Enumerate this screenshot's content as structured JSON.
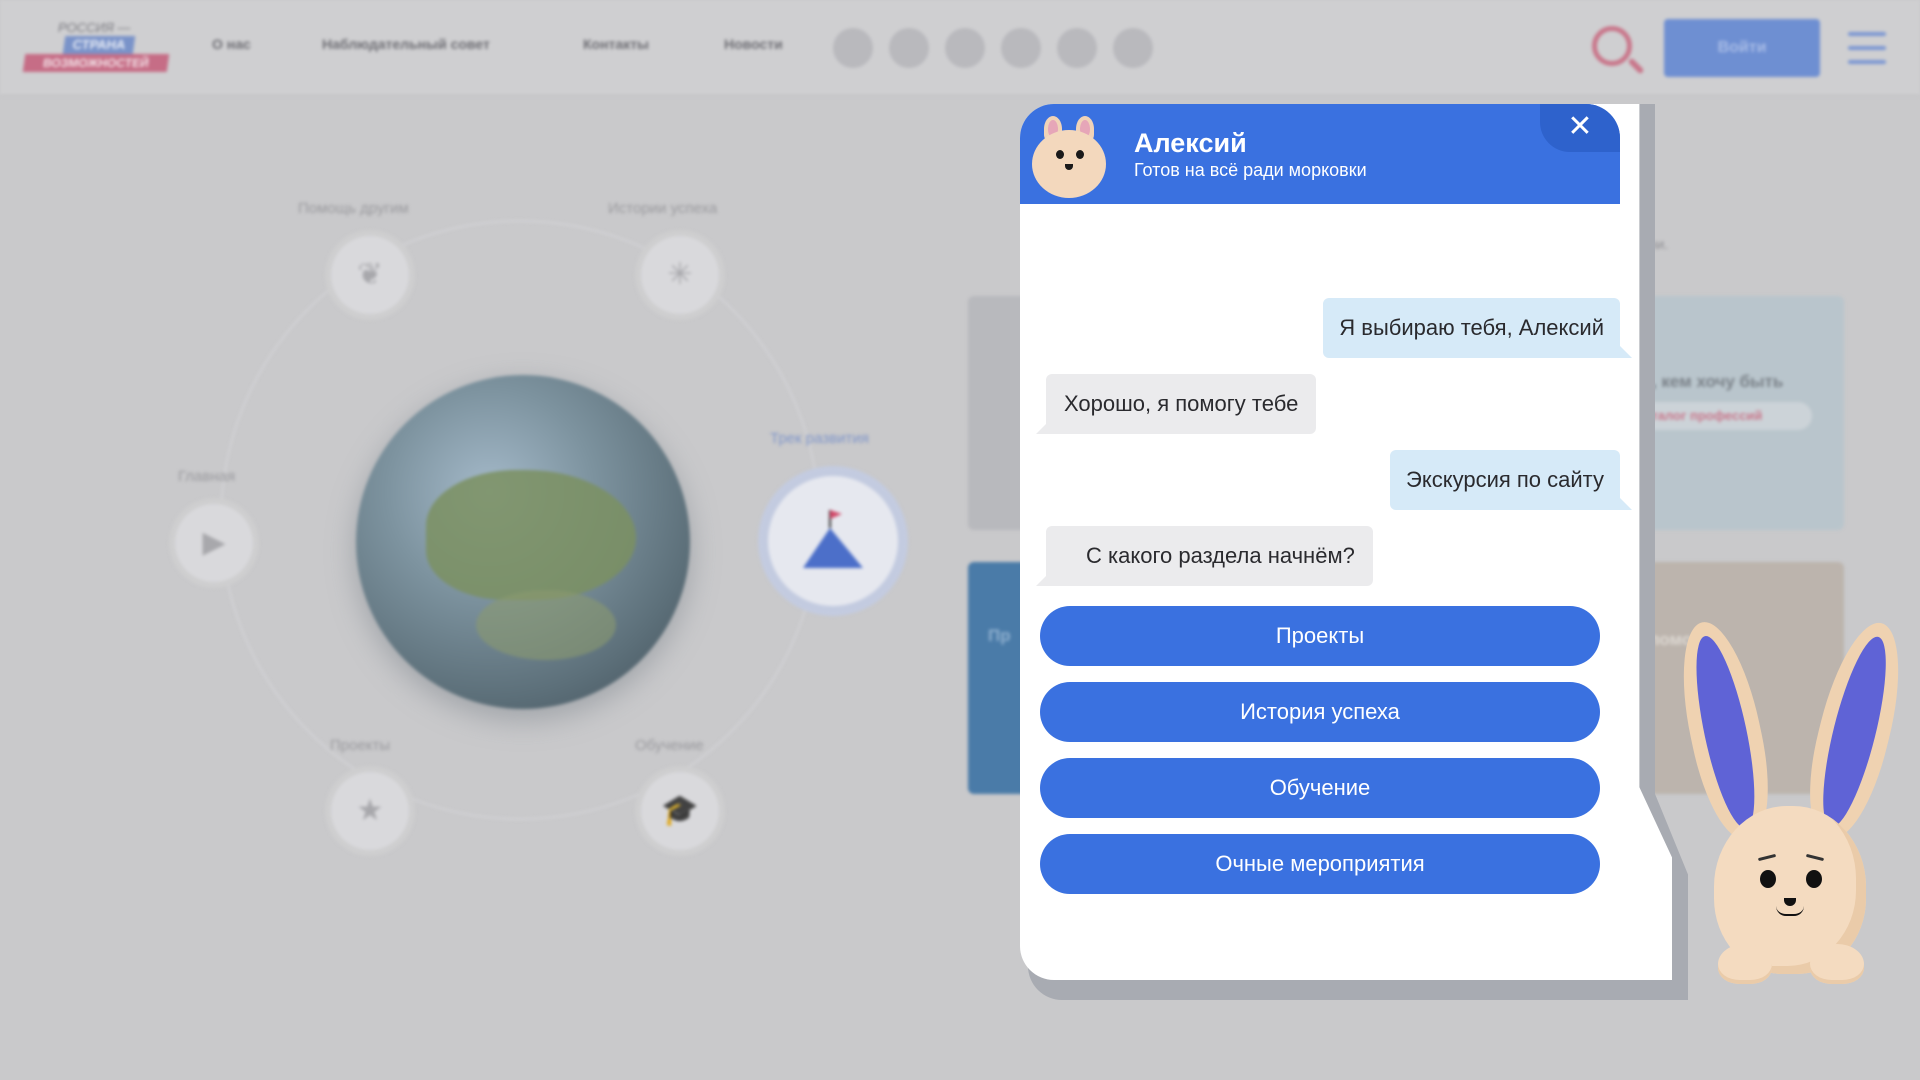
{
  "background": {
    "logo": {
      "line1": "РОССИЯ —",
      "line2": "СТРАНА",
      "line3": "ВОЗМОЖНОСТЕЙ"
    },
    "nav": [
      "О нас",
      "Наблюдательный совет",
      "Контакты",
      "Новости"
    ],
    "social_icons": [
      "vk-icon",
      "odnoklassniki-icon",
      "instagram-icon",
      "facebook-icon",
      "telegram-icon",
      "youtube-icon"
    ],
    "login_label": "Войти",
    "orbit_nodes": {
      "help": "Помощь другим",
      "stories": "Истории успеха",
      "main": "Главная",
      "track": "Трек развития",
      "projects": "Проекты",
      "education": "Обучение"
    },
    "snippets": {
      "life": "жизни.",
      "want_to_be": "аю, кем хочу быть",
      "catalog": "Каталог профессий",
      "diploma": "ипломом",
      "projects_short": "Пр"
    }
  },
  "chat": {
    "bot_name": "Алексий",
    "bot_status": "Готов на всё ради морковки",
    "close_symbol": "✕",
    "messages": [
      {
        "from": "user",
        "text": "Я выбираю тебя, Алексий"
      },
      {
        "from": "bot",
        "text": "Хорошо, я помогу тебе"
      },
      {
        "from": "user",
        "text": "Экскурсия по сайту"
      },
      {
        "from": "bot",
        "text": "С какого раздела начнём?"
      }
    ],
    "options": [
      "Проекты",
      "История успеха",
      "Обучение",
      "Очные мероприятия"
    ]
  },
  "colors": {
    "accent": "#3a71e0",
    "user_bubble": "#d6eaf8",
    "bot_bubble": "#ebebed",
    "overlay": "#c9c9cb"
  }
}
